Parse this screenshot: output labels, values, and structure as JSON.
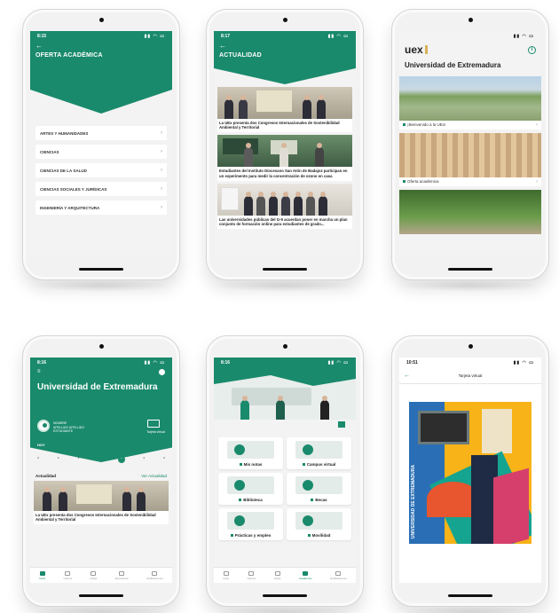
{
  "phones": {
    "academic": {
      "time": "8:15",
      "title": "OFERTA ACADÉMICA",
      "items": [
        "ARTES Y HUMANIDADES",
        "CIENCIAS",
        "CIENCIAS DE LA SALUD",
        "CIENCIAS SOCIALES Y JURÍDICAS",
        "INGENIERÍA Y ARQUITECTURA"
      ]
    },
    "news": {
      "time": "8:17",
      "title": "ACTUALIDAD",
      "items": [
        "La UEx presenta dos Congresos Internacionales de Sostenibilidad Ambiental y Territorial",
        "Estudiantes del Instituto Diocesano San Atón de Badajoz participan en un experimento para medir la concentración de ozono en casa",
        "Las universidades públicas del G-9 acuerdan poner en marcha un plan conjunto de formación online para estudiantes de grado..."
      ]
    },
    "home": {
      "logo": "uex",
      "title": "Universidad de Extremadura",
      "cards": [
        "¡Bienvenido a la UEx!",
        "Oferta académica"
      ]
    },
    "dashboard": {
      "time": "8:16",
      "title": "Universidad de Extremadura",
      "user_lines": [
        "NOMBRE",
        "APELLIDO APELLIDO",
        "ESTUDIANTE"
      ],
      "card_label": "Tarjeta virtual",
      "today": "HOY",
      "section": "Actualidad",
      "see_all": "Ver Actualidad",
      "news_title": "La UEx presenta dos Congresos Internacionales de Sostenibilidad Ambiental y Territorial",
      "tabs": [
        "Inicio",
        "Carnés",
        "Notas",
        "Expediente",
        "Notificaciones"
      ]
    },
    "services": {
      "time": "8:16",
      "tiles": [
        "Mis notas",
        "Campus virtual",
        "Biblioteca",
        "Becas",
        "Prácticas y empleo",
        "Movilidad"
      ],
      "tabs": [
        "Inicio",
        "Carnés",
        "Notas",
        "Académico",
        "Notificaciones"
      ]
    },
    "card": {
      "time": "10:51",
      "title": "Tarjeta virtual",
      "cover_text": "UNIVERSIDAD DE EXTREMADURA"
    }
  },
  "colors": {
    "brand": "#1a8a6c",
    "accent": "#f7b318"
  }
}
